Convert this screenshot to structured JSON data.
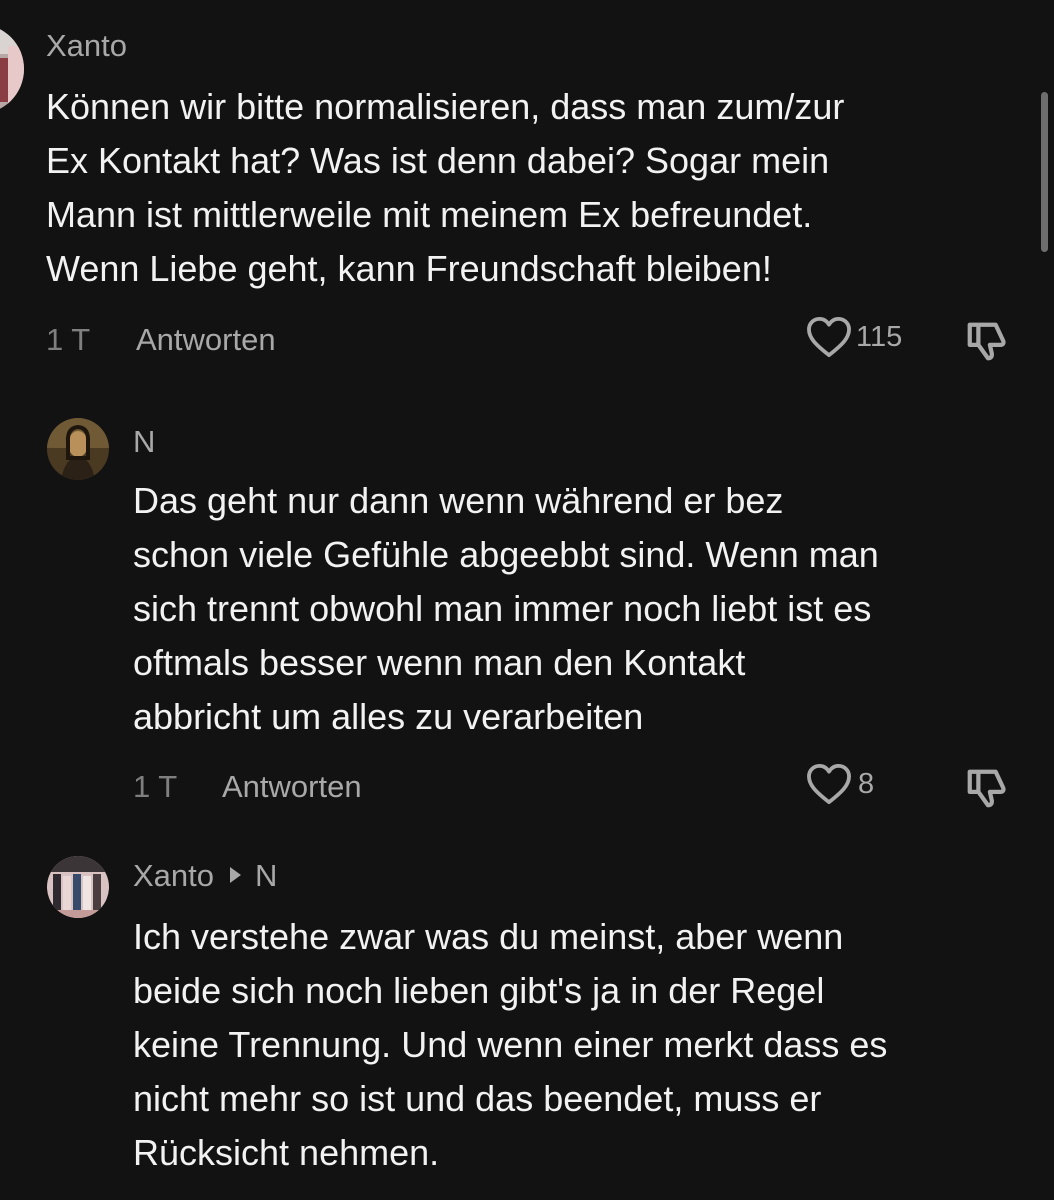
{
  "comments": [
    {
      "username": "Xanto",
      "lines": [
        "Können wir bitte normalisieren, dass man zum/zur",
        "Ex Kontakt hat? Was ist denn dabei? Sogar mein",
        "Mann ist mittlerweile mit meinem Ex befreundet.",
        "Wenn Liebe geht, kann Freundschaft bleiben!"
      ],
      "time": "1 T",
      "reply_label": "Antworten",
      "likes": "115",
      "icons": {
        "like": "heart-icon",
        "dislike": "thumbs-down-icon"
      }
    },
    {
      "username": "N",
      "lines": [
        "Das geht nur dann wenn während er bez",
        "schon viele Gefühle abgeebbt sind. Wenn man",
        "sich trennt obwohl man immer noch liebt ist es",
        "oftmals besser wenn man den Kontakt",
        "abbricht um alles zu verarbeiten"
      ],
      "time": "1 T",
      "reply_label": "Antworten",
      "likes": "8",
      "icons": {
        "like": "heart-icon",
        "dislike": "thumbs-down-icon"
      }
    },
    {
      "username": "Xanto",
      "reply_to": "N",
      "lines": [
        "Ich verstehe zwar was du meinst, aber wenn",
        "beide sich noch lieben gibt's ja in der Regel",
        "keine Trennung. Und wenn einer merkt dass es",
        "nicht mehr so ist und das beendet, muss er",
        "Rücksicht nehmen."
      ]
    }
  ],
  "colors": {
    "background": "#121212",
    "text": "#f2f2f2",
    "secondary": "#a8a8a8",
    "muted": "#7f7f7f"
  }
}
